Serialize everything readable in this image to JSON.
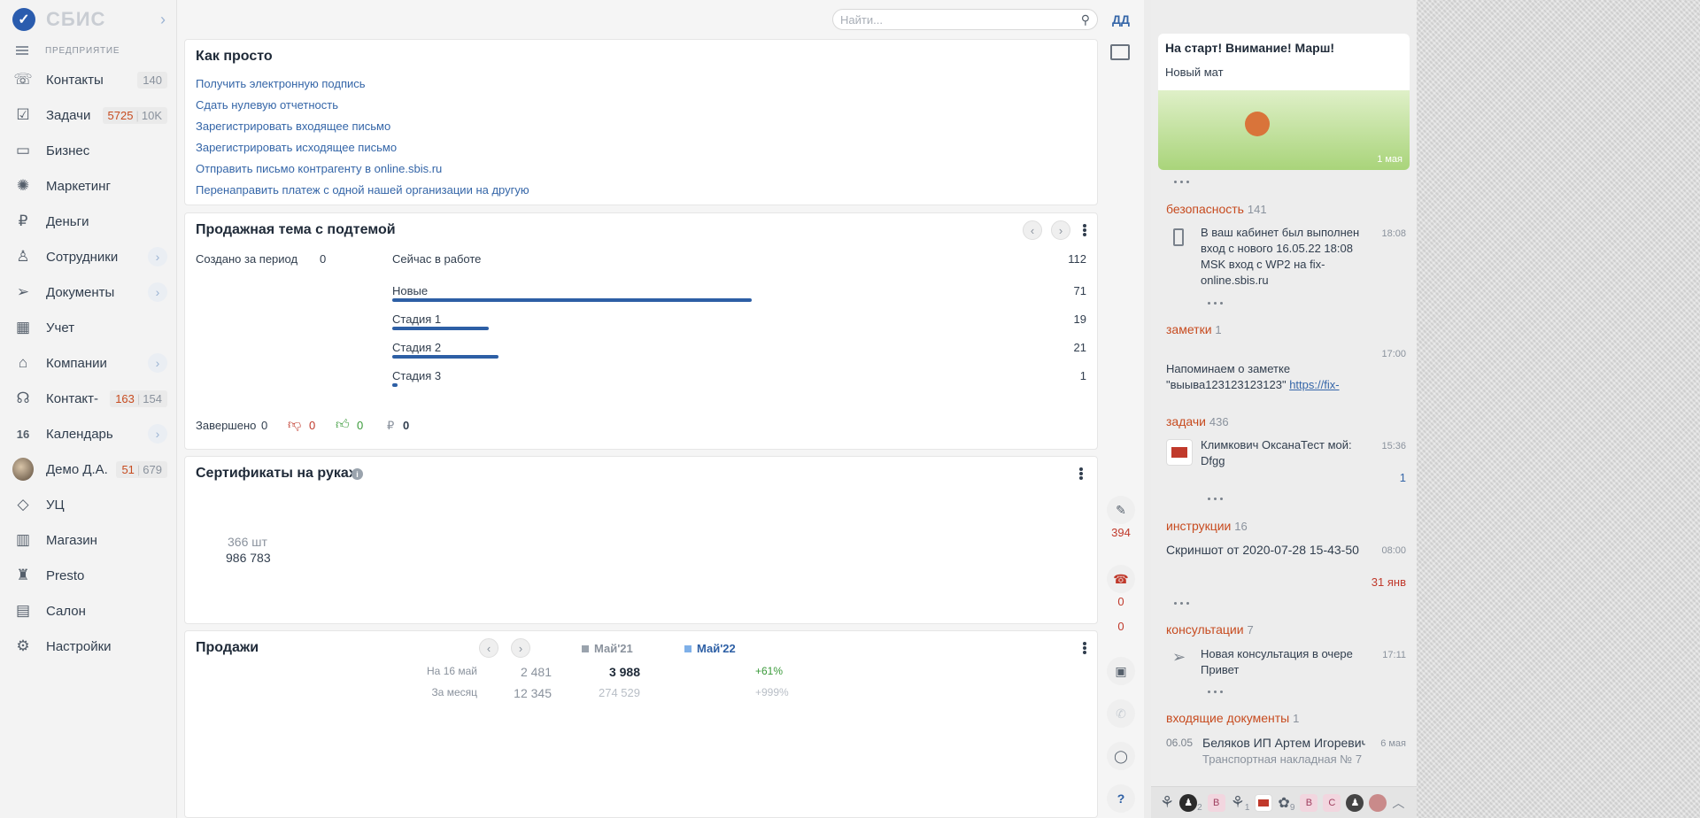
{
  "app": {
    "logo_letter": "✓",
    "logo_text": "СБИС",
    "org_label": "ПРЕДПРИЯТИЕ",
    "user_initials": "ДД",
    "accent": "#2d5fa5",
    "alert": "#c74b1f"
  },
  "sidebar": {
    "items": [
      {
        "label": "Контакты",
        "icon": "contacts-icon",
        "glyph": "☏",
        "count_b": "140"
      },
      {
        "label": "Задачи",
        "icon": "tasks-icon",
        "glyph": "☑",
        "count_a": "5725",
        "count_b": "10K"
      },
      {
        "label": "Бизнес",
        "icon": "business-icon",
        "glyph": "▭"
      },
      {
        "label": "Маркетинг",
        "icon": "marketing-icon",
        "glyph": "✺"
      },
      {
        "label": "Деньги",
        "icon": "money-icon",
        "glyph": "₽"
      },
      {
        "label": "Сотрудники",
        "icon": "employees-icon",
        "glyph": "♙",
        "chevron": "›"
      },
      {
        "label": "Документы",
        "icon": "documents-icon",
        "glyph": "➢",
        "chevron": "›"
      },
      {
        "label": "Учет",
        "icon": "accounting-icon",
        "glyph": "▦"
      },
      {
        "label": "Компании",
        "icon": "companies-icon",
        "glyph": "⌂",
        "chevron": "›"
      },
      {
        "label": "Контакт-",
        "icon": "contact-center-icon",
        "glyph": "☊",
        "count_a": "163",
        "count_b": "154"
      },
      {
        "label": "Календарь",
        "icon": "calendar-icon",
        "glyph": "16",
        "chevron": "›"
      },
      {
        "label": "Демо Д.А.",
        "icon": "user-avatar",
        "glyph": "",
        "count_a": "51",
        "count_b": "679"
      },
      {
        "label": "УЦ",
        "icon": "certificate-center-icon",
        "glyph": "◇"
      },
      {
        "label": "Магазин",
        "icon": "shop-icon",
        "glyph": "▥"
      },
      {
        "label": "Presto",
        "icon": "presto-icon",
        "glyph": "♜"
      },
      {
        "label": "Салон",
        "icon": "salon-icon",
        "glyph": "▤"
      },
      {
        "label": "Настройки",
        "icon": "settings-icon",
        "glyph": "⚙"
      }
    ]
  },
  "search": {
    "placeholder": "Найти..."
  },
  "easy": {
    "title": "Как просто",
    "links": [
      "Получить электронную подпись",
      "Сдать нулевую отчетность",
      "Зарегистрировать входящее письмо",
      "Зарегистрировать исходящее письмо",
      "Отправить письмо контрагенту в online.sbis.ru",
      "Перенаправить платеж с одной нашей организации на другую"
    ]
  },
  "sales_theme": {
    "title": "Продажная тема с подтемой",
    "created_label": "Создано за период",
    "created_value": "0",
    "in_work_label": "Сейчас в работе",
    "in_work_value": "112",
    "stages": [
      {
        "label": "Новые",
        "value": 71
      },
      {
        "label": "Стадия 1",
        "value": 19
      },
      {
        "label": "Стадия 2",
        "value": 21
      },
      {
        "label": "Стадия 3",
        "value": 1
      }
    ],
    "done_label": "Завершено",
    "done_value": "0",
    "dislike_value": "0",
    "like_value": "0",
    "rub_sign": "₽",
    "rub_value": "0"
  },
  "certificates": {
    "title": "Сертификаты на руках",
    "count": "366 шт",
    "amount": "986 783"
  },
  "sales": {
    "title": "Продажи",
    "col_a": "Май'21",
    "col_b": "Май'22",
    "color_a": "#9aa3ad",
    "color_b": "#7fb0e8",
    "rows": [
      {
        "label": "На 16 май",
        "a": "2 481",
        "b": "3 988",
        "delta": "+61%"
      },
      {
        "label": "За месяц",
        "a": "12 345",
        "b": "274 529",
        "delta": "+999%"
      }
    ]
  },
  "vtoolbar": {
    "count_1": "394",
    "count_2": "0",
    "count_3": "0",
    "help": "?"
  },
  "feed": {
    "promo_title": "На старт! Внимание! Марш!",
    "promo_sub": "Новый мат",
    "promo_date": "1 мая",
    "security": {
      "label": "безопасность",
      "count": "141",
      "time": "18:08",
      "text": "В ваш кабинет был выполнен вход с нового 16.05.22 18:08 MSK вход с WP2 на fix-online.sbis.ru"
    },
    "notes": {
      "label": "заметки",
      "count": "1",
      "time": "17:00",
      "text": "Напоминаем о заметке \"выыва123123123123\"",
      "link": "https://fix-"
    },
    "tasks": {
      "label": "задачи",
      "count": "436",
      "time": "15:36",
      "text": "Климкович ОксанаТест мой: Dfgg",
      "badge": "1"
    },
    "instructions": {
      "label": "инструкции",
      "count": "16",
      "time": "08:00",
      "text": "Скриншот от 2020-07-28 15-43-50",
      "date": "31 янв"
    },
    "consult": {
      "label": "консультации",
      "count": "7",
      "time": "17:11",
      "text": "Новая консультация в очере",
      "sub": "Привет"
    },
    "incoming": {
      "label": "входящие документы",
      "count": "1",
      "date_l": "06.05",
      "text": "Беляков ИП Артем Игоревич",
      "sub": "Транспортная накладная № 7",
      "date_r": "6 мая"
    }
  },
  "bottombar": {
    "n1": "2",
    "n2": "1",
    "n3": "9",
    "chip_b": "В",
    "chip_c": "С"
  }
}
